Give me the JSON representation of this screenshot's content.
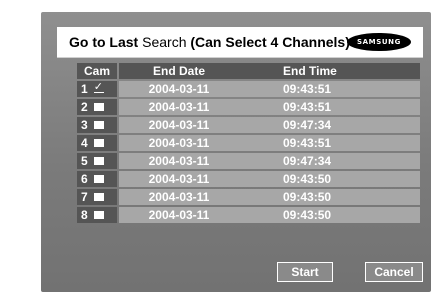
{
  "title": {
    "bold_part": "Go to Last",
    "normal_part": " Search ",
    "bold_suffix": "(Can Select 4 Channels)"
  },
  "logo_text": "SAMSUNG",
  "columns": {
    "cam": "Cam",
    "end_date": "End Date",
    "end_time": "End Time"
  },
  "rows": [
    {
      "cam": "1",
      "checked": true,
      "end_date": "2004-03-11",
      "end_time": "09:43:51"
    },
    {
      "cam": "2",
      "checked": false,
      "end_date": "2004-03-11",
      "end_time": "09:43:51"
    },
    {
      "cam": "3",
      "checked": false,
      "end_date": "2004-03-11",
      "end_time": "09:47:34"
    },
    {
      "cam": "4",
      "checked": false,
      "end_date": "2004-03-11",
      "end_time": "09:43:51"
    },
    {
      "cam": "5",
      "checked": false,
      "end_date": "2004-03-11",
      "end_time": "09:47:34"
    },
    {
      "cam": "6",
      "checked": false,
      "end_date": "2004-03-11",
      "end_time": "09:43:50"
    },
    {
      "cam": "7",
      "checked": false,
      "end_date": "2004-03-11",
      "end_time": "09:43:50"
    },
    {
      "cam": "8",
      "checked": false,
      "end_date": "2004-03-11",
      "end_time": "09:43:50"
    }
  ],
  "buttons": {
    "start": "Start",
    "cancel": "Cancel"
  }
}
